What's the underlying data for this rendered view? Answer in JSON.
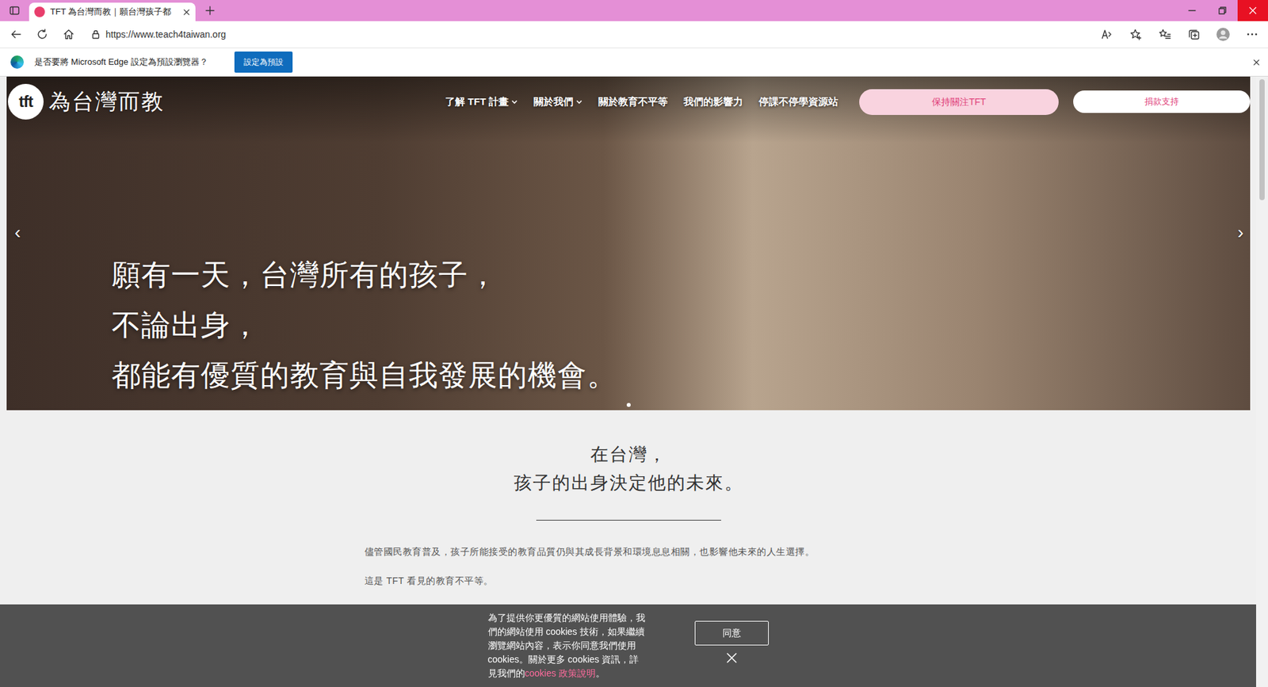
{
  "window": {
    "tabs": [
      {
        "label": "TFT 為台灣而教｜願台灣孩子都",
        "selected": true
      }
    ],
    "address": "https://www.teach4taiwan.org",
    "infobar": {
      "message": "是否要將 Microsoft Edge 設定為預設瀏覽器？",
      "button": "設定為預設"
    },
    "scrollbar": {
      "level": 0.2
    }
  },
  "site": {
    "logo": {
      "mark": "tft",
      "name": "為台灣而教"
    },
    "nav": [
      {
        "label": "了解 TFT 計畫",
        "dropdown": true
      },
      {
        "label": "關於我們",
        "dropdown": true
      },
      {
        "label": "關於教育不平等",
        "dropdown": false
      },
      {
        "label": "我們的影響力",
        "dropdown": false
      },
      {
        "label": "停課不停學資源站",
        "dropdown": false
      }
    ],
    "actions": [
      {
        "label": "保持關注TFT",
        "kind": "primary"
      },
      {
        "label": "捐款支持",
        "kind": "secondary"
      }
    ],
    "hero": {
      "lines": [
        "願有一天，台灣所有的孩子，",
        "不論出身，",
        "都能有優質的教育與自我發展的機會。"
      ],
      "prev": "‹",
      "next": "›",
      "slides": [
        {
          "selected": true
        }
      ]
    },
    "intro": {
      "heading": [
        "在台灣，",
        "孩子的出身決定他的未來。"
      ],
      "paragraphs": [
        "儘管國民教育普及，孩子所能接受的教育品質仍與其成長背景和環境息息相關，也影響他未來的人生選擇。",
        "這是 TFT 看見的教育不平等。"
      ]
    }
  },
  "cookie_banner": {
    "text": "為了提供你更優質的網站使用體驗，我們的網站使用 cookies 技術，如果繼續瀏覽網站內容，表示你同意我們使用 cookies。關於更多 cookies 資訊，詳見我們的",
    "link": "cookies 政策說明",
    "end": "。",
    "accept": "同意"
  }
}
